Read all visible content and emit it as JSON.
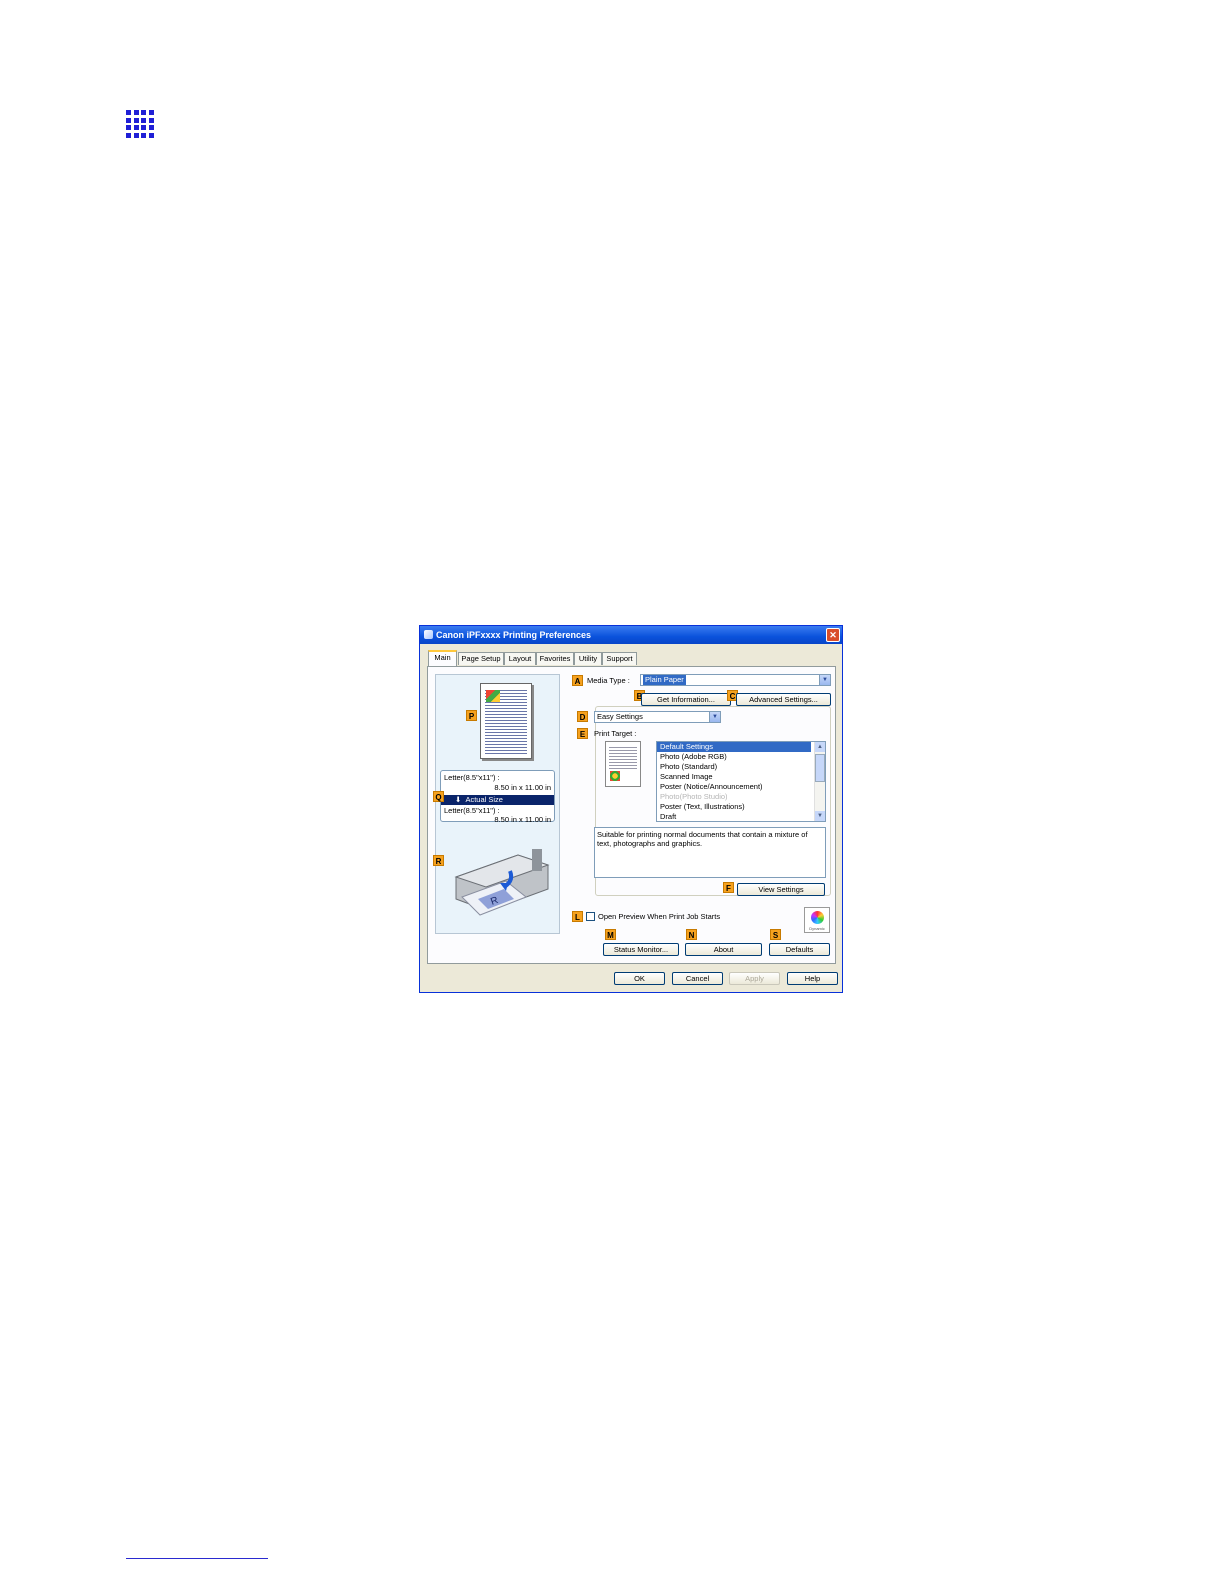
{
  "dialog": {
    "title": "Canon iPFxxxx Printing Preferences",
    "close_glyph": "✕",
    "tabs": [
      "Main",
      "Page Setup",
      "Layout",
      "Favorites",
      "Utility",
      "Support"
    ],
    "active_tab": "Main",
    "labels": {
      "media_type": "Media Type :",
      "print_target": "Print Target :"
    },
    "media_type_value": "Plain Paper",
    "mode_value": "Easy Settings",
    "buttons": {
      "get_information": "Get Information...",
      "advanced_settings": "Advanced Settings...",
      "view_settings": "View Settings",
      "status_monitor": "Status Monitor...",
      "about": "About",
      "defaults": "Defaults",
      "ok": "OK",
      "cancel": "Cancel",
      "apply": "Apply",
      "help": "Help"
    },
    "print_target_items": [
      "Default Settings",
      "Photo (Adobe RGB)",
      "Photo (Standard)",
      "Scanned Image",
      "Poster (Notice/Announcement)",
      "Photo(Photo Studio)",
      "Poster (Text, Illustrations)",
      "Draft"
    ],
    "print_target_selected_index": 0,
    "print_target_disabled_index": 5,
    "description": "Suitable for printing normal documents that contain a mixture of text, photographs and graphics.",
    "open_preview_label": "Open Preview When Print Job Starts",
    "open_preview_checked": false,
    "color_icon_caption": "Dynamic",
    "preview": {
      "original_size": "Letter(8.5\"x11\") :",
      "original_dims": "8.50 in x 11.00 in",
      "scaling": "Actual Size",
      "output_size": "Letter(8.5\"x11\") :",
      "output_dims": "8.50 in x 11.00 in"
    },
    "callouts": {
      "A": "A",
      "B": "B",
      "C": "C",
      "D": "D",
      "E": "E",
      "F": "F",
      "L": "L",
      "M": "M",
      "N": "N",
      "S": "S",
      "P": "P",
      "Q": "Q",
      "R": "R"
    },
    "colors": {
      "title_bar": "#0a52dc",
      "selection": "#316ac5",
      "callout": "#f6a21f",
      "background": "#ece9d8"
    }
  },
  "page": {
    "section_icon": "grid-icon"
  }
}
